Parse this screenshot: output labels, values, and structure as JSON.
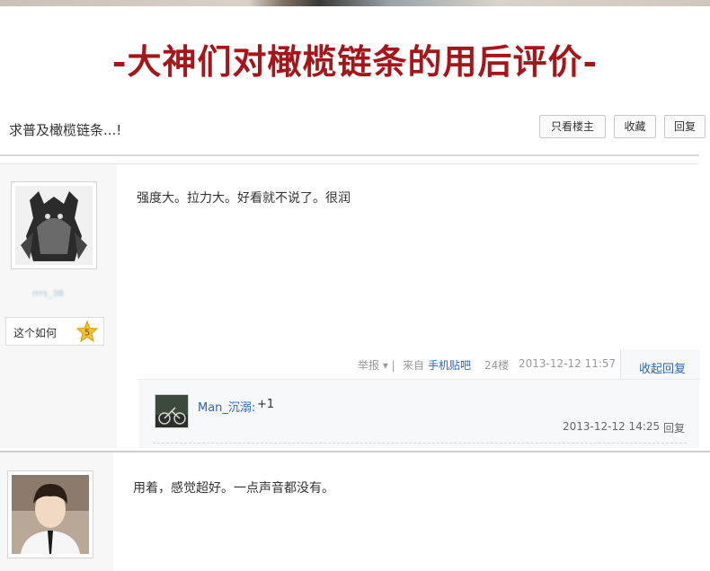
{
  "banner": {
    "text": "-大神们对橄榄链条的用后评价-"
  },
  "thread": {
    "title": "求普及橄榄链条...!",
    "buttons": {
      "only_author": "只看楼主",
      "favorite": "收藏",
      "reply": "回复"
    }
  },
  "posts": [
    {
      "username": "rrrs_38",
      "rank_label": "这个如何",
      "level": "5",
      "content": "强度大。拉力大。好看就不说了。很润",
      "tail": {
        "report": "举报 ▾ |",
        "from": "来自",
        "source": "手机贴吧",
        "floor": "24楼",
        "date": "2013-12-12 11:57",
        "collapse": "收起回复"
      },
      "replies": [
        {
          "user": "Man_沉溺:",
          "text": "+1",
          "time": "2013-12-12 14:25",
          "reply_label": "回复"
        }
      ]
    },
    {
      "content": "用着，感觉超好。一点声音都没有。"
    }
  ],
  "colors": {
    "banner": "#a4161a",
    "link": "#2d64b3",
    "sidebar_bg": "#f7f7f7",
    "meta_text": "#999999"
  },
  "icons": [
    "level-star-icon",
    "dropdown-arrow-icon"
  ]
}
